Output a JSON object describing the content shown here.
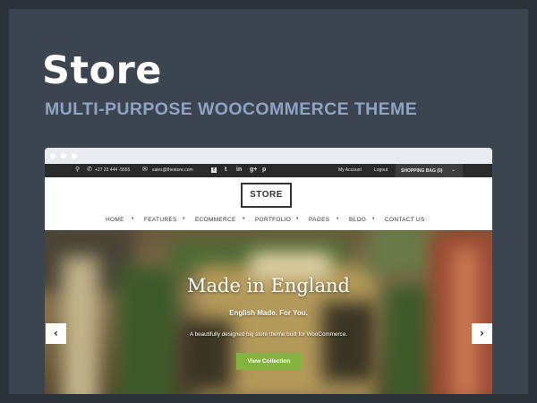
{
  "promo": {
    "title": "Store",
    "subtitle": "MULTI-PURPOSE WOOCOMMERCE THEME"
  },
  "topbar": {
    "phone": "+27 23 444 -5555",
    "email": "sales@thestore.com",
    "my_account": "My Account",
    "logout": "Logout",
    "shopping_bag": "SHOPPING BAG (0)",
    "social_icons": [
      "facebook-icon",
      "twitter-icon",
      "linkedin-icon",
      "google-plus-icon",
      "pinterest-icon"
    ]
  },
  "logo": "STORE",
  "nav": [
    "HOME",
    "FEATURES",
    "ECOMMERCE",
    "PORTFOLIO",
    "PAGES",
    "BLOG",
    "CONTACT US"
  ],
  "hero": {
    "title": "Made in England",
    "tagline": "English Made. For You.",
    "description": "A beautifully designed big store theme built for WooCommerce.",
    "button": "View Collection"
  },
  "colors": {
    "background": "#3c4450",
    "subtitle": "#8fa3c4",
    "button": "#84b440",
    "topbar": "#2a2a2a"
  }
}
